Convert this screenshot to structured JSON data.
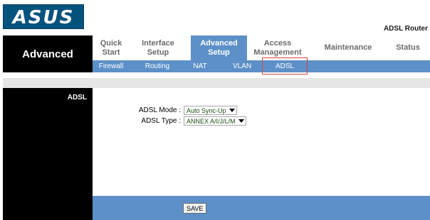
{
  "brand": {
    "logo_text": "ASUS",
    "product": "ADSL Router"
  },
  "nav": {
    "section": "Advanced",
    "tabs": [
      {
        "line1": "Quick",
        "line2": "Start"
      },
      {
        "line1": "Interface",
        "line2": "Setup"
      },
      {
        "line1": "Advanced",
        "line2": "Setup"
      },
      {
        "line1": "Access",
        "line2": "Management"
      },
      {
        "line1": "Maintenance",
        "line2": ""
      },
      {
        "line1": "Status",
        "line2": ""
      }
    ],
    "subtabs": [
      "Firewall",
      "Routing",
      "NAT",
      "VLAN",
      "ADSL"
    ]
  },
  "sidebar": {
    "title": "ADSL"
  },
  "form": {
    "mode": {
      "label": "ADSL Mode :",
      "value": "Auto Sync-Up"
    },
    "type": {
      "label": "ADSL Type :",
      "value": "ANNEX A/I/J/L/M"
    }
  },
  "footer": {
    "save_label": "SAVE"
  },
  "colors": {
    "accent": "#5d90c8",
    "logo_bg": "#04527e",
    "highlight": "#d9453a"
  }
}
